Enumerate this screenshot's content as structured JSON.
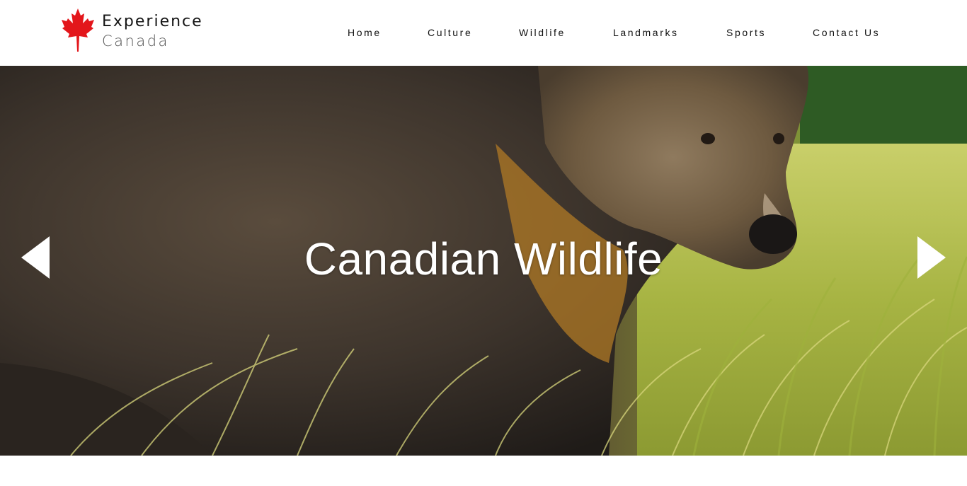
{
  "brand": {
    "line1": "Experience",
    "line2": "Canada",
    "logo_icon": "maple-leaf-icon",
    "leaf_color": "#e3161b"
  },
  "nav": {
    "items": [
      {
        "label": "Home"
      },
      {
        "label": "Culture"
      },
      {
        "label": "Wildlife"
      },
      {
        "label": "Landmarks"
      },
      {
        "label": "Sports"
      },
      {
        "label": "Contact Us"
      }
    ]
  },
  "hero": {
    "title": "Canadian Wildlife",
    "prev_icon": "chevron-left-icon",
    "next_icon": "chevron-right-icon",
    "image_subject": "grizzly bear in grass"
  },
  "colors": {
    "text_dark": "#111111",
    "hero_text": "#ffffff",
    "background": "#ffffff"
  }
}
